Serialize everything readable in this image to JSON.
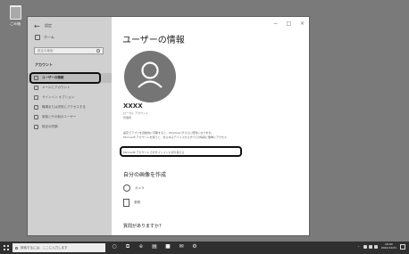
{
  "desktop": {
    "recycle_bin_label": "ごみ箱"
  },
  "window": {
    "back_glyph": "←",
    "title": "設定",
    "controls": {
      "minimize": "−",
      "maximize": "□",
      "close": "×"
    }
  },
  "sidebar": {
    "home_label": "ホーム",
    "search_placeholder": "設定の検索",
    "section_title": "アカウント",
    "items": [
      {
        "label": "ユーザーの情報",
        "icon": "user-info-icon",
        "active": true
      },
      {
        "label": "メールとアカウント",
        "icon": "mail-icon",
        "active": false
      },
      {
        "label": "サインイン オプション",
        "icon": "key-icon",
        "active": false
      },
      {
        "label": "職場または学校にアクセスする",
        "icon": "briefcase-icon",
        "active": false
      },
      {
        "label": "家族とその他のユーザー",
        "icon": "people-icon",
        "active": false
      },
      {
        "label": "設定の同期",
        "icon": "sync-icon",
        "active": false
      }
    ]
  },
  "main": {
    "title": "ユーザーの情報",
    "avatar_icon": "user-avatar-icon",
    "account_name": "XXXX",
    "account_line_1": "ローカル アカウント",
    "account_line_2": "管理者",
    "notice_line_1": "設定でアプリを自動的に同期すると、Windows がさらに便利になります。",
    "notice_line_2": "Microsoft アカウントを使うと、あらゆるデバイスからすべての情報に簡単にアクセス",
    "link_text": "Microsoft アカウントでのサインインに切り替える",
    "picture_heading": "自分の画像を作成",
    "camera_label": "カメラ",
    "browse_label": "参照",
    "question": "質問がありますか?"
  },
  "taskbar": {
    "search_placeholder": "検索するには、ここに入力します",
    "apps": [
      {
        "name": "cortana",
        "glyph": "○"
      },
      {
        "name": "task-view",
        "glyph": "⧉"
      },
      {
        "name": "edge",
        "glyph": "e"
      },
      {
        "name": "explorer",
        "glyph": "▤"
      },
      {
        "name": "store",
        "glyph": "■"
      },
      {
        "name": "mail",
        "glyph": "✉"
      },
      {
        "name": "settings",
        "glyph": "⚙"
      }
    ],
    "tray": {
      "chevron": "^",
      "time": "18:00",
      "date": "2022/12/31"
    }
  },
  "colors": {
    "desktop": "#7a7a7a",
    "sidebar": "#d0d0d0",
    "avatar": "#757575",
    "taskbar": "#2f2f2f"
  }
}
